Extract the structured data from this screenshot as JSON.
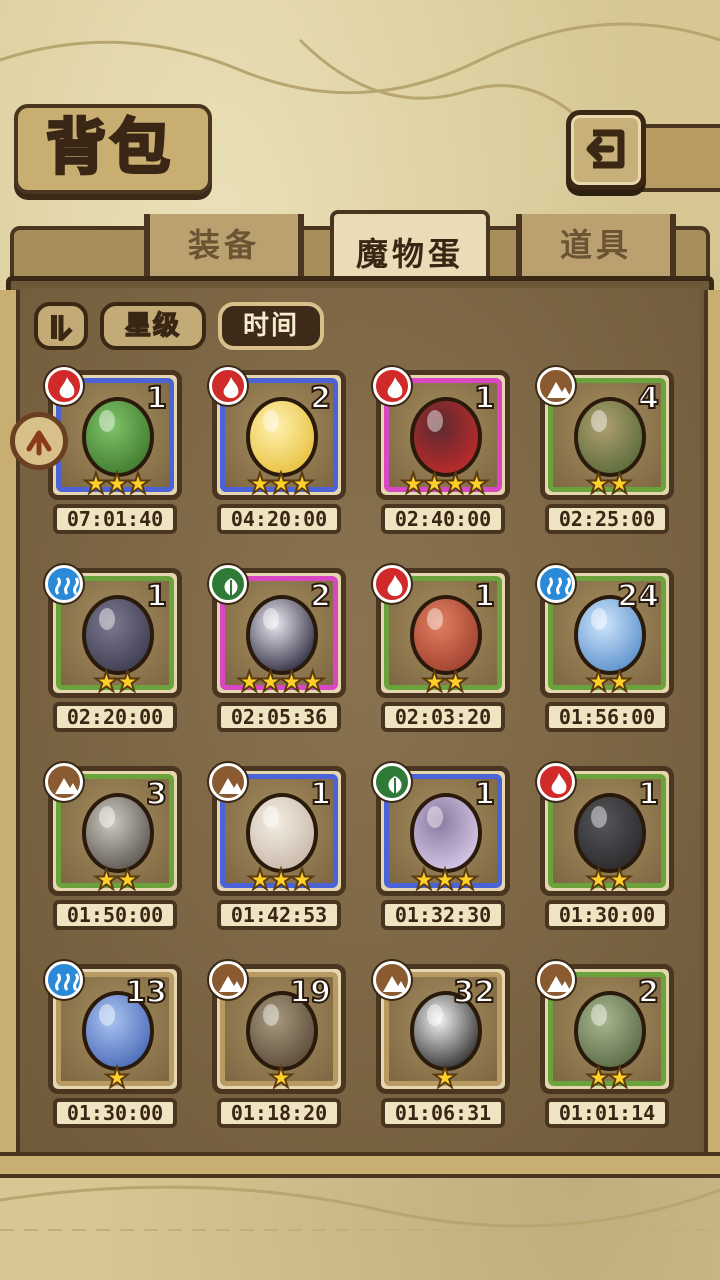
{
  "header": {
    "title": "背包",
    "back_icon": "return-arrow-icon"
  },
  "tabs": [
    {
      "label": "装备",
      "active": false
    },
    {
      "label": "魔物蛋",
      "active": true
    },
    {
      "label": "道具",
      "active": false
    }
  ],
  "sort": {
    "toggle_icon": "sort-order-icon",
    "star_label": "星级",
    "time_label": "时间",
    "active": "时间"
  },
  "scroll_up_icon": "scroll-up-icon",
  "colors": {
    "fire": "#d12a2a",
    "water": "#2a8ad8",
    "earth": "#8a5a30",
    "wood": "#2f7a36",
    "frame_blue": "#4b63d6",
    "frame_pink": "#d947c2",
    "frame_green": "#6aa33c",
    "frame_tan": "#b89a62"
  },
  "eggs": [
    {
      "count": "1",
      "stars": "★★★",
      "time": "07:01:40",
      "element": "fire",
      "frame": "blue",
      "egg_icon": "cactus-egg-icon"
    },
    {
      "count": "2",
      "stars": "★★★",
      "time": "04:20:00",
      "element": "fire",
      "frame": "blue",
      "egg_icon": "sun-egg-icon"
    },
    {
      "count": "1",
      "stars": "★★★★",
      "time": "02:40:00",
      "element": "fire",
      "frame": "pink",
      "egg_icon": "dark-flame-egg-icon"
    },
    {
      "count": "4",
      "stars": "★★",
      "time": "02:25:00",
      "element": "earth",
      "frame": "green",
      "egg_icon": "vine-egg-icon"
    },
    {
      "count": "1",
      "stars": "★★",
      "time": "02:20:00",
      "element": "water",
      "frame": "green",
      "egg_icon": "shell-egg-icon"
    },
    {
      "count": "2",
      "stars": "★★★★",
      "time": "02:05:36",
      "element": "wood",
      "frame": "pink",
      "egg_icon": "spiked-collar-egg-icon"
    },
    {
      "count": "1",
      "stars": "★★",
      "time": "02:03:20",
      "element": "fire",
      "frame": "green",
      "egg_icon": "fire-rock-egg-icon"
    },
    {
      "count": "24",
      "stars": "★★",
      "time": "01:56:00",
      "element": "water",
      "frame": "green",
      "egg_icon": "flask-egg-icon"
    },
    {
      "count": "3",
      "stars": "★★",
      "time": "01:50:00",
      "element": "earth",
      "frame": "green",
      "egg_icon": "gray-fur-egg-icon"
    },
    {
      "count": "1",
      "stars": "★★★",
      "time": "01:42:53",
      "element": "earth",
      "frame": "blue",
      "egg_icon": "fluffy-egg-icon"
    },
    {
      "count": "1",
      "stars": "★★★",
      "time": "01:32:30",
      "element": "wood",
      "frame": "blue",
      "egg_icon": "iridescent-egg-icon"
    },
    {
      "count": "1",
      "stars": "★★",
      "time": "01:30:00",
      "element": "fire",
      "frame": "green",
      "egg_icon": "stone-armor-egg-icon"
    },
    {
      "count": "13",
      "stars": "★",
      "time": "01:30:00",
      "element": "water",
      "frame": "tan",
      "egg_icon": "blue-fur-egg-icon"
    },
    {
      "count": "19",
      "stars": "★",
      "time": "01:18:20",
      "element": "earth",
      "frame": "tan",
      "egg_icon": "helmet-egg-icon"
    },
    {
      "count": "32",
      "stars": "★",
      "time": "01:06:31",
      "element": "earth",
      "frame": "tan",
      "egg_icon": "striped-egg-icon"
    },
    {
      "count": "2",
      "stars": "★★",
      "time": "01:01:14",
      "element": "earth",
      "frame": "green",
      "egg_icon": "leaf-egg-icon"
    }
  ]
}
